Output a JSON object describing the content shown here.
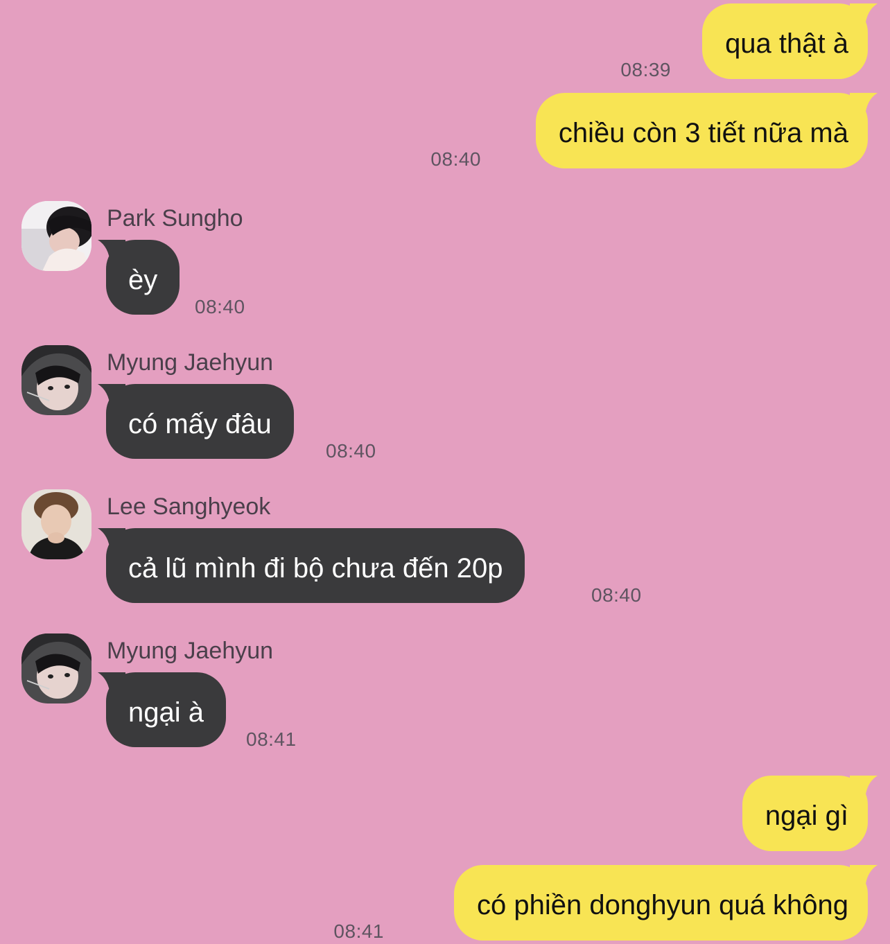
{
  "colors": {
    "background": "#E49FC0",
    "outgoing_bubble": "#F8E454",
    "incoming_bubble": "#3A3A3C",
    "timestamp": "#5E5460",
    "sender_name": "#4A3F4A"
  },
  "messages": [
    {
      "direction": "outgoing",
      "text": "qua thật à",
      "time": "08:39"
    },
    {
      "direction": "outgoing",
      "text": "chiều còn 3 tiết nữa mà",
      "time": "08:40"
    },
    {
      "direction": "incoming",
      "sender": "Park Sungho",
      "avatar_icon": "person-photo-icon",
      "text": "èy",
      "time": "08:40"
    },
    {
      "direction": "incoming",
      "sender": "Myung Jaehyun",
      "avatar_icon": "person-photo-icon",
      "text": "có mấy đâu",
      "time": "08:40"
    },
    {
      "direction": "incoming",
      "sender": "Lee Sanghyeok",
      "avatar_icon": "person-photo-icon",
      "text": "cả lũ mình đi bộ chưa đến 20p",
      "time": "08:40"
    },
    {
      "direction": "incoming",
      "sender": "Myung Jaehyun",
      "avatar_icon": "person-photo-icon",
      "text": "ngại à",
      "time": "08:41"
    },
    {
      "direction": "outgoing",
      "text": "ngại gì",
      "time": ""
    },
    {
      "direction": "outgoing",
      "text": "có phiền donghyun quá không",
      "time": "08:41"
    }
  ]
}
